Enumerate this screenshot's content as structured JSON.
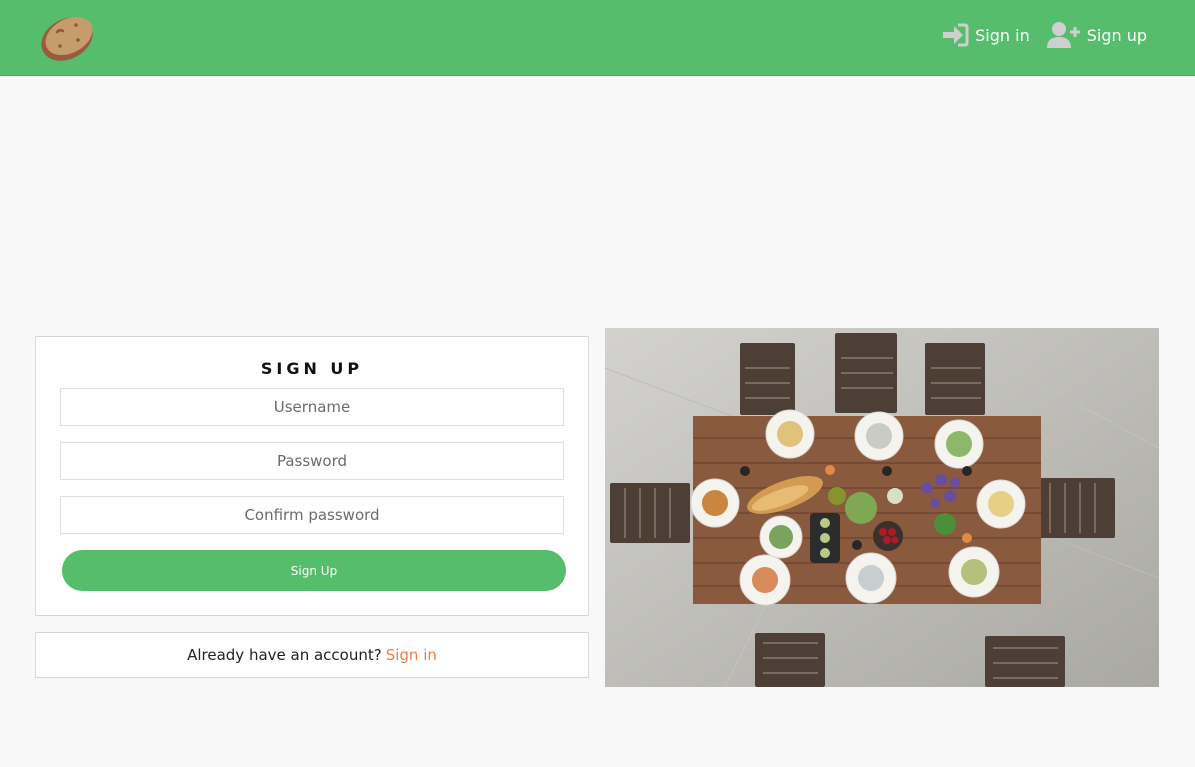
{
  "header": {
    "logo_icon": "potato-logo-icon",
    "nav": [
      {
        "label": "Sign in",
        "icon": "sign-in-icon"
      },
      {
        "label": "Sign up",
        "icon": "user-plus-icon"
      }
    ]
  },
  "form": {
    "title": "SIGN UP",
    "username_placeholder": "Username",
    "password_placeholder": "Password",
    "confirm_placeholder": "Confirm password",
    "submit_label": "Sign Up"
  },
  "signin": {
    "prompt": "Already have an account?",
    "link": "Sign in"
  },
  "colors": {
    "brand_green": "#55bd6b",
    "link_orange": "#f47a4a"
  }
}
